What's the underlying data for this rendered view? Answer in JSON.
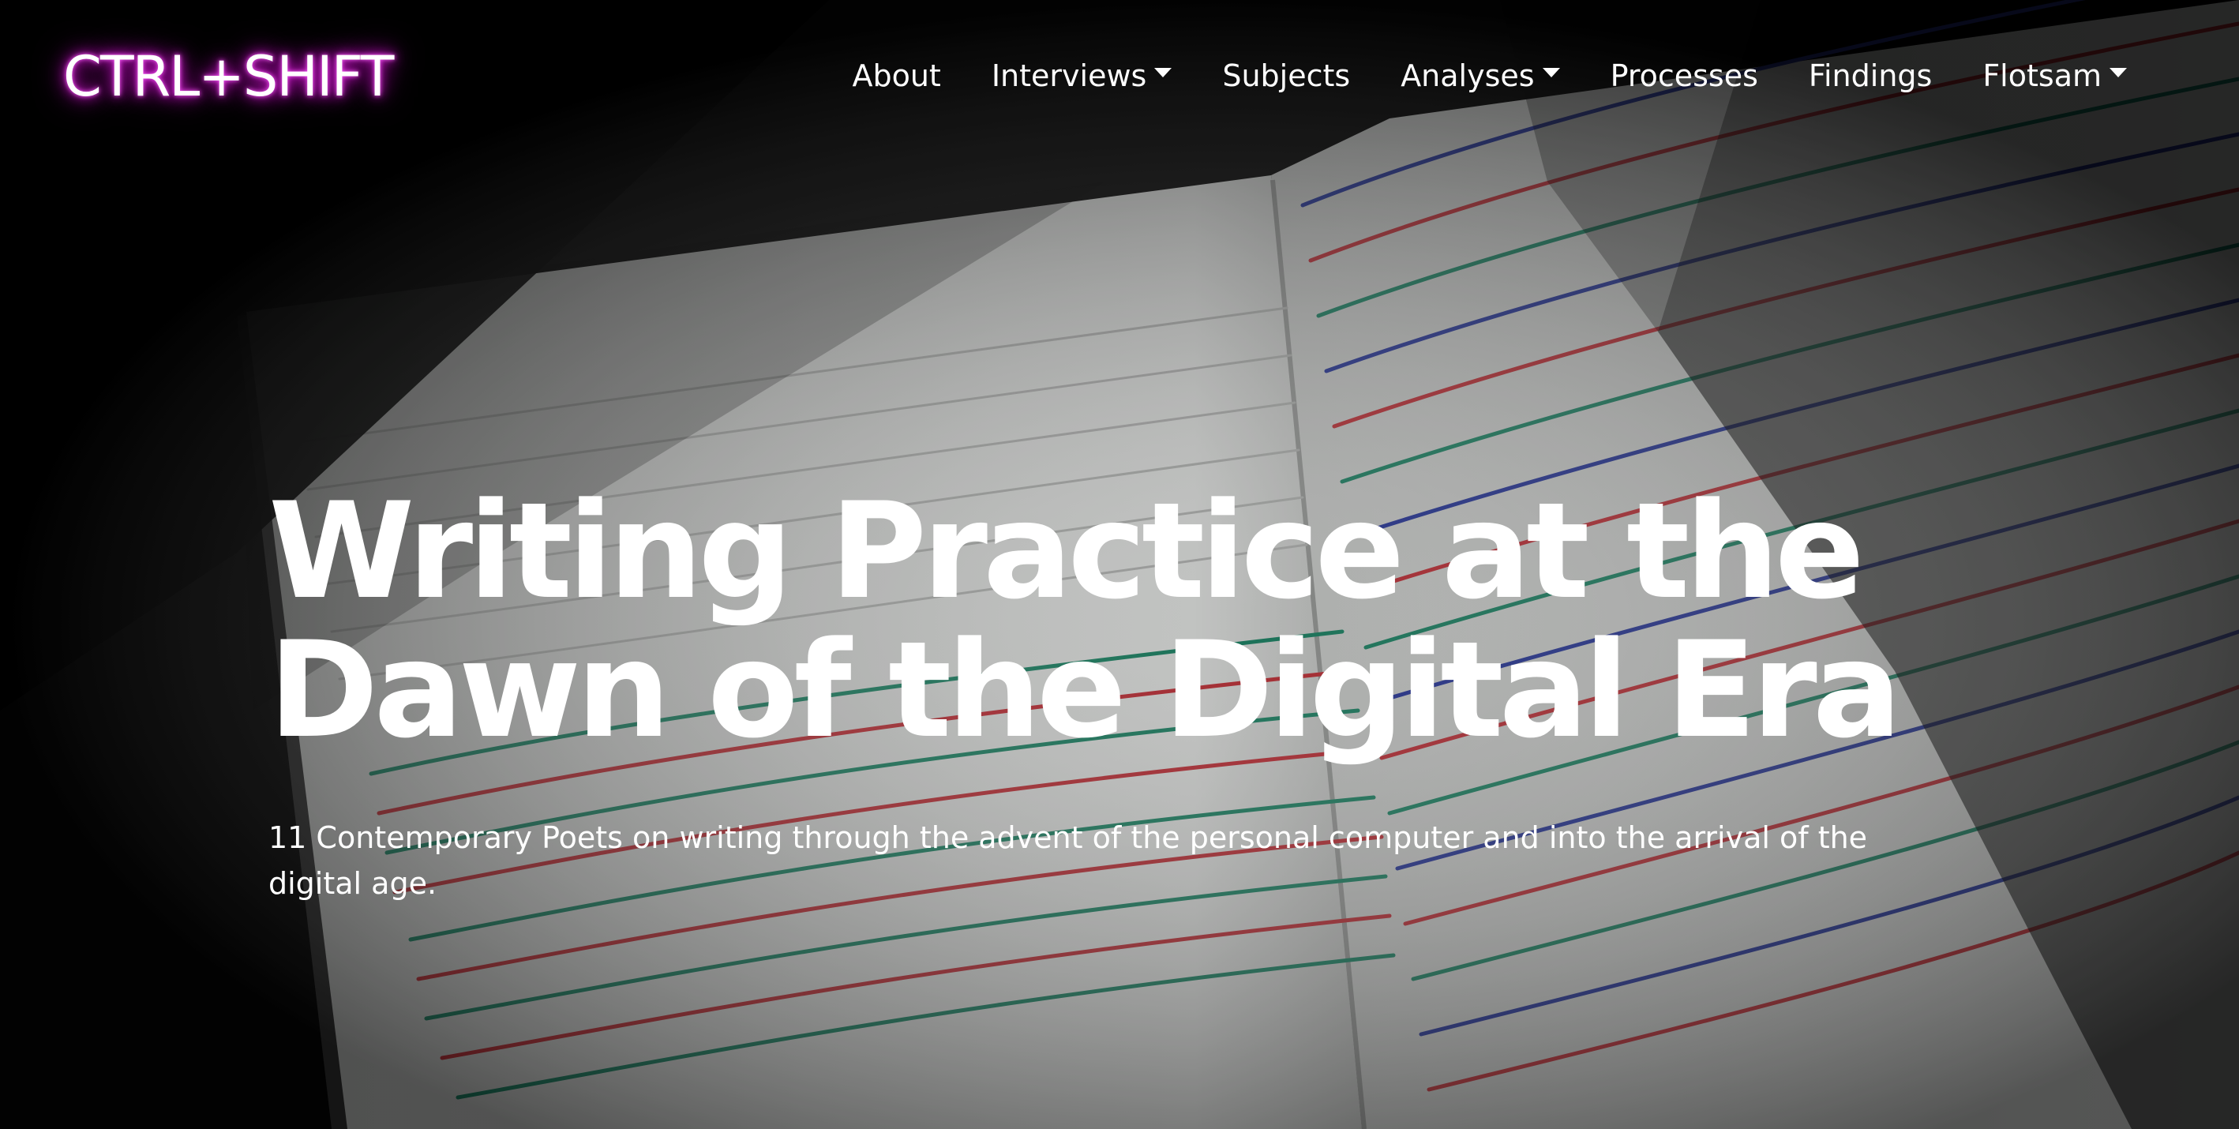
{
  "brand": {
    "name": "CTRL+SHIFT",
    "glow_color": "#d21ad2"
  },
  "nav": {
    "items": [
      {
        "label": "About",
        "dropdown": false
      },
      {
        "label": "Interviews",
        "dropdown": true
      },
      {
        "label": "Subjects",
        "dropdown": false
      },
      {
        "label": "Analyses",
        "dropdown": true
      },
      {
        "label": "Processes",
        "dropdown": false
      },
      {
        "label": "Findings",
        "dropdown": false
      },
      {
        "label": "Flotsam",
        "dropdown": true
      }
    ]
  },
  "hero": {
    "title": "Writing Practice at the Dawn of the Digital Era",
    "subtitle": "11 Contemporary Poets on writing through the advent of the personal computer and into the arrival of the digital age.",
    "background_image": "open-handwritten-notebook-under-spotlight"
  },
  "colors": {
    "background": "#050505",
    "text": "#ffffff",
    "ink_red": "#c8323a",
    "ink_green": "#1f8a6a",
    "ink_blue": "#2a3aa0"
  }
}
